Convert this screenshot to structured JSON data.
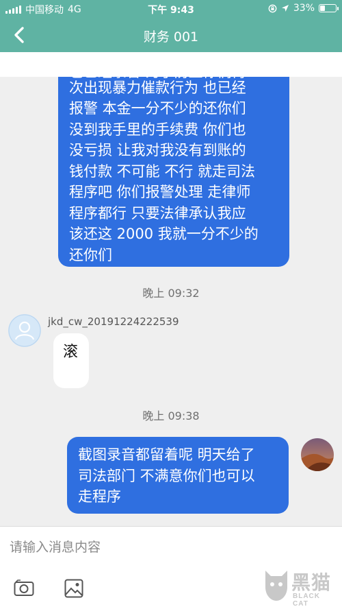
{
  "status_bar": {
    "carrier": "中国移动",
    "network": "4G",
    "time": "下午 9:43",
    "battery_percent": "33%",
    "battery_level": 0.33
  },
  "nav": {
    "title": "财务 001",
    "back_icon": "chevron-left-icon"
  },
  "messages": {
    "first_outgoing_partial": "也已经录音 为了防止你们再",
    "first_outgoing_lines": [
      "次出现暴力催款行为 也已经",
      "报警 本金一分不少的还你们",
      "没到我手里的手续费 你们也",
      "没亏损 让我对我没有到账的",
      "钱付款 不可能 不行 就走司法",
      "程序吧 你们报警处理 走律师",
      "程序都行 只要法律承认我应",
      "该还这 2000 我就一分不少的",
      "还你们"
    ],
    "time_1": "晚上 09:32",
    "incoming_sender": "jkd_cw_20191224222539",
    "incoming_text": "滚",
    "time_2": "晚上 09:38",
    "second_outgoing_lines": [
      "截图录音都留着呢 明天给了",
      "司法部门 不满意你们也可以",
      "走程序"
    ]
  },
  "input": {
    "placeholder": "请输入消息内容",
    "camera_icon": "camera-icon",
    "image_icon": "image-icon"
  },
  "watermark": {
    "title": "黑猫",
    "subtitle": "BLACK CAT"
  },
  "colors": {
    "header": "#5fb3a3",
    "bubble_out": "#2f6fe0",
    "bubble_in": "#ffffff",
    "background": "#efefef"
  }
}
